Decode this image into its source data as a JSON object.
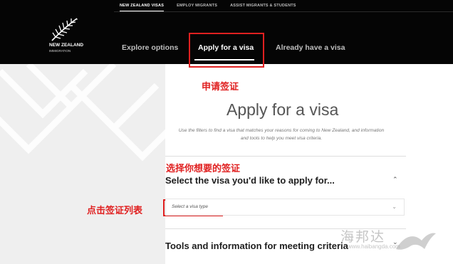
{
  "top_links": [
    {
      "label": "NEW ZEALAND VISAS",
      "active": true
    },
    {
      "label": "EMPLOY MIGRANTS",
      "active": false
    },
    {
      "label": "ASSIST MIGRANTS & STUDENTS",
      "active": false
    }
  ],
  "logo": {
    "line1": "NEW ZEALAND",
    "line2": "IMMIGRATION",
    "icon": "silver-fern-icon"
  },
  "nav_tabs": [
    {
      "label": "Explore options",
      "active": false
    },
    {
      "label": "Apply for a visa",
      "active": true
    },
    {
      "label": "Already have a visa",
      "active": false
    }
  ],
  "annotations": {
    "apply_tab": "申请签证",
    "select_visa": "选择你想要的签证",
    "click_list": "点击签证列表",
    "color": "#e02020"
  },
  "main": {
    "title": "Apply for a visa",
    "intro": "Use the filters to find a visa that matches your reasons for coming to New Zealand, and information and tools to help you meet visa criteria.",
    "section1_title": "Select the visa you'd like to apply for...",
    "section1_icon": "chevron-up-icon",
    "select_placeholder": "Select a visa type",
    "select_icon": "chevron-down-icon",
    "section2_title": "Tools and information for meeting criteria",
    "section2_icon": "chevron-down-icon"
  },
  "watermark": {
    "cn": "海邦达",
    "en": "www.haibangda.com"
  }
}
